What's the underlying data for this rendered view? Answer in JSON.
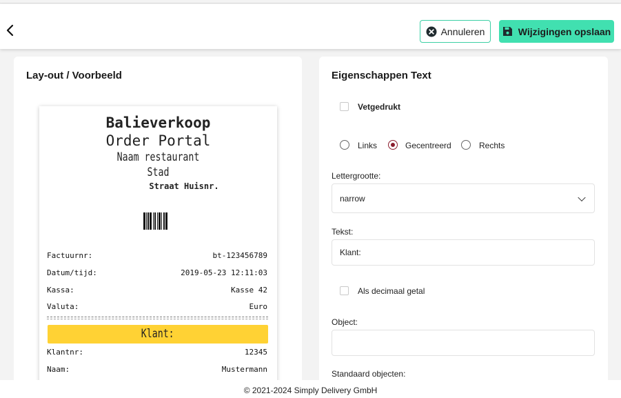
{
  "header": {
    "back_icon": "chevron-left-icon",
    "cancel_label": "Annuleren",
    "save_label": "Wijzigingen opslaan",
    "accent_color": "#41e0b0"
  },
  "left_panel": {
    "title": "Lay-out / Voorbeeld",
    "receipt": {
      "title": "Balieverkoop",
      "subtitle": "Order Portal",
      "restaurant": "Naam restaurant",
      "city": "Stad",
      "street": "Straat Huisnr.",
      "rows": [
        {
          "label": "Factuurnr:",
          "value": "bt-123456789"
        },
        {
          "label": "Datum/tijd:",
          "value": "2019-05-23 12:11:03"
        },
        {
          "label": "Kassa:",
          "value": "Kasse 42"
        },
        {
          "label": "Valuta:",
          "value": "Euro"
        }
      ],
      "highlight": "Klant:",
      "highlight_color": "#ffd234",
      "rows_after": [
        {
          "label": "Klantnr:",
          "value": "12345"
        },
        {
          "label": "Naam:",
          "value": "Mustermann"
        }
      ]
    }
  },
  "right_panel": {
    "title": "Eigenschappen Text",
    "bold_label": "Vetgedrukt",
    "align_options": [
      {
        "label": "Links",
        "selected": false
      },
      {
        "label": "Gecentreerd",
        "selected": true
      },
      {
        "label": "Rechts",
        "selected": false
      }
    ],
    "font_size_label": "Lettergrootte:",
    "font_size_value": "narrow",
    "text_label": "Tekst:",
    "text_value": "Klant:",
    "decimal_label": "Als decimaal getal",
    "object_label": "Object:",
    "object_value": "",
    "standard_objects_label": "Standaard objecten:"
  },
  "footer": {
    "copyright": "© 2021-2024 Simply Delivery GmbH"
  }
}
